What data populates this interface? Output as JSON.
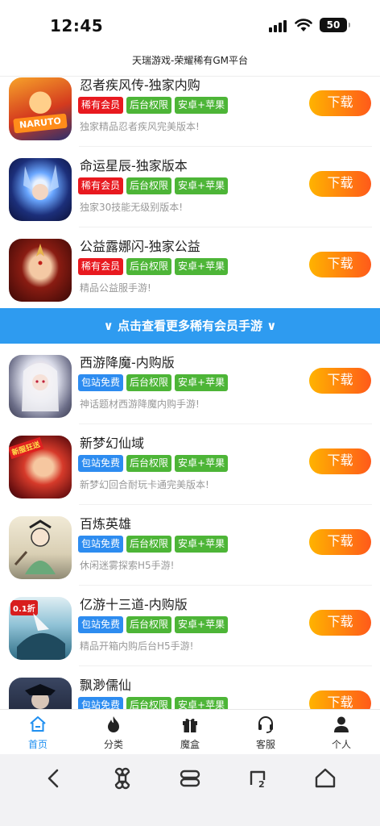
{
  "status_bar": {
    "time": "12:45",
    "battery": "50"
  },
  "header": {
    "title": "天瑞游戏-荣耀稀有GM平台"
  },
  "games_top": [
    {
      "name": "忍者疾风传-独家内购",
      "tags": [
        "稀有会员",
        "后台权限",
        "安卓+苹果"
      ],
      "desc": "独家精品忍者疾风完美版本!",
      "button": "下载",
      "icon": "naruto-game-icon"
    },
    {
      "name": "命运星辰-独家版本",
      "tags": [
        "稀有会员",
        "后台权限",
        "安卓+苹果"
      ],
      "desc": "独家30技能无级别版本!",
      "button": "下载",
      "icon": "fate-stars-game-icon"
    },
    {
      "name": "公益露娜闪-独家公益",
      "tags": [
        "稀有会员",
        "后台权限",
        "安卓+苹果"
      ],
      "desc": "精品公益服手游!",
      "button": "下载",
      "icon": "luna-game-icon"
    }
  ],
  "more_banner": "∨ 点击查看更多稀有会员手游 ∨",
  "games_bottom": [
    {
      "name": "西游降魔-内购版",
      "tags": [
        "包站免费",
        "后台权限",
        "安卓+苹果"
      ],
      "desc": "神话题材西游降魔内购手游!",
      "button": "下载",
      "icon": "journey-west-game-icon"
    },
    {
      "name": "新梦幻仙域",
      "tags": [
        "包站免费",
        "后台权限",
        "安卓+苹果"
      ],
      "desc": "新梦幻回合耐玩卡通完美版本!",
      "button": "下载",
      "icon": "dream-fairy-game-icon",
      "badge": "新服狂送"
    },
    {
      "name": "百炼英雄",
      "tags": [
        "包站免费",
        "后台权限",
        "安卓+苹果"
      ],
      "desc": "休闲迷雾探索H5手游!",
      "button": "下载",
      "icon": "hero-game-icon"
    },
    {
      "name": "亿游十三道-内购版",
      "tags": [
        "包站免费",
        "后台权限",
        "安卓+苹果"
      ],
      "desc": "精品开箱内购后台H5手游!",
      "button": "下载",
      "icon": "thirteen-roads-game-icon",
      "badge": "0.1折"
    },
    {
      "name": "飘渺儒仙",
      "tags": [
        "包站免费",
        "后台权限",
        "安卓+苹果"
      ],
      "desc": "",
      "button": "下载",
      "icon": "scholar-immortal-game-icon"
    }
  ],
  "tabbar": {
    "items": [
      {
        "label": "首页",
        "icon": "home-icon",
        "active": true
      },
      {
        "label": "分类",
        "icon": "fire-icon",
        "active": false
      },
      {
        "label": "魔盒",
        "icon": "gift-icon",
        "active": false
      },
      {
        "label": "客服",
        "icon": "headset-icon",
        "active": false
      },
      {
        "label": "个人",
        "icon": "person-icon",
        "active": false
      }
    ]
  },
  "colors": {
    "accent": "#2e9bf0",
    "tag_red": "#e8191f",
    "tag_green": "#4db537",
    "tag_blue": "#2d8cf0",
    "button_start": "#ffb300",
    "button_end": "#ff5a1a"
  }
}
